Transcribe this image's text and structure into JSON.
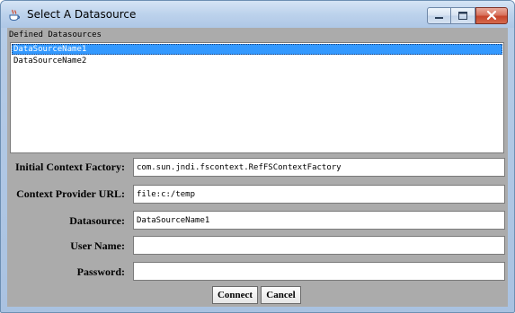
{
  "window": {
    "title": "Select A Datasource",
    "icon": "java-cup-icon"
  },
  "controls": {
    "minimize_icon": "minimize-icon",
    "maximize_icon": "maximize-icon",
    "close_icon": "close-icon",
    "close_color": "#c7432a"
  },
  "datasources": {
    "section_label": "Defined Datasources",
    "items": [
      {
        "label": "DataSourceName1",
        "selected": true
      },
      {
        "label": "DataSourceName2",
        "selected": false
      }
    ],
    "selection_color": "#3399ff"
  },
  "form": {
    "initial_context_factory": {
      "label": "Initial Context Factory:",
      "value": "com.sun.jndi.fscontext.RefFSContextFactory"
    },
    "context_provider_url": {
      "label": "Context Provider URL:",
      "value": "file:c:/temp"
    },
    "datasource": {
      "label": "Datasource:",
      "value": "DataSourceName1"
    },
    "user_name": {
      "label": "User Name:",
      "value": ""
    },
    "password": {
      "label": "Password:",
      "value": ""
    }
  },
  "buttons": {
    "connect_label": "Connect",
    "cancel_label": "Cancel"
  }
}
